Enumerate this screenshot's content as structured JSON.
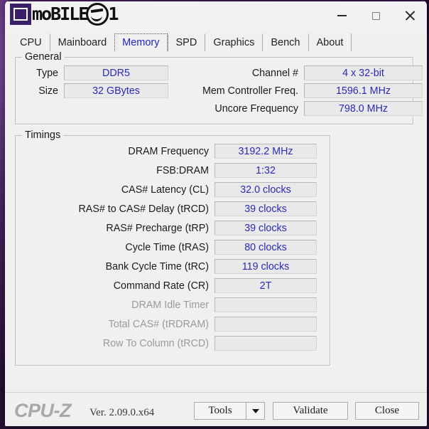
{
  "window": {
    "watermark": "mobile01",
    "controls": {
      "minimize": "minimize-button",
      "maximize": "maximize-button",
      "close": "close-button"
    }
  },
  "tabs": [
    {
      "label": "CPU",
      "active": false
    },
    {
      "label": "Mainboard",
      "active": false
    },
    {
      "label": "Memory",
      "active": true
    },
    {
      "label": "SPD",
      "active": false
    },
    {
      "label": "Graphics",
      "active": false
    },
    {
      "label": "Bench",
      "active": false
    },
    {
      "label": "About",
      "active": false
    }
  ],
  "general": {
    "title": "General",
    "left_rows": [
      {
        "label": "Type",
        "value": "DDR5"
      },
      {
        "label": "Size",
        "value": "32 GBytes"
      }
    ],
    "right_rows": [
      {
        "label": "Channel #",
        "value": "4 x 32-bit"
      },
      {
        "label": "Mem Controller Freq.",
        "value": "1596.1 MHz"
      },
      {
        "label": "Uncore Frequency",
        "value": "798.0 MHz"
      }
    ]
  },
  "timings": {
    "title": "Timings",
    "rows": [
      {
        "label": "DRAM Frequency",
        "value": "3192.2 MHz",
        "disabled": false
      },
      {
        "label": "FSB:DRAM",
        "value": "1:32",
        "disabled": false
      },
      {
        "label": "CAS# Latency (CL)",
        "value": "32.0 clocks",
        "disabled": false
      },
      {
        "label": "RAS# to CAS# Delay (tRCD)",
        "value": "39 clocks",
        "disabled": false
      },
      {
        "label": "RAS# Precharge (tRP)",
        "value": "39 clocks",
        "disabled": false
      },
      {
        "label": "Cycle Time (tRAS)",
        "value": "80 clocks",
        "disabled": false
      },
      {
        "label": "Bank Cycle Time (tRC)",
        "value": "119 clocks",
        "disabled": false
      },
      {
        "label": "Command Rate (CR)",
        "value": "2T",
        "disabled": false
      },
      {
        "label": "DRAM Idle Timer",
        "value": "",
        "disabled": true
      },
      {
        "label": "Total CAS# (tRDRAM)",
        "value": "",
        "disabled": true
      },
      {
        "label": "Row To Column (tRCD)",
        "value": "",
        "disabled": true
      }
    ]
  },
  "footer": {
    "brand": "CPU-Z",
    "version": "Ver. 2.09.0.x64",
    "tools_label": "Tools",
    "tools_dropdown_icon": "chevron-down-icon",
    "validate_label": "Validate",
    "close_label": "Close"
  },
  "colors": {
    "value_text": "#2a2ab4",
    "active_tab_text": "#2222cc",
    "disabled_label": "#9a9a9a",
    "window_bg": "#f0f0f0",
    "field_bg": "#e9e9e9"
  }
}
